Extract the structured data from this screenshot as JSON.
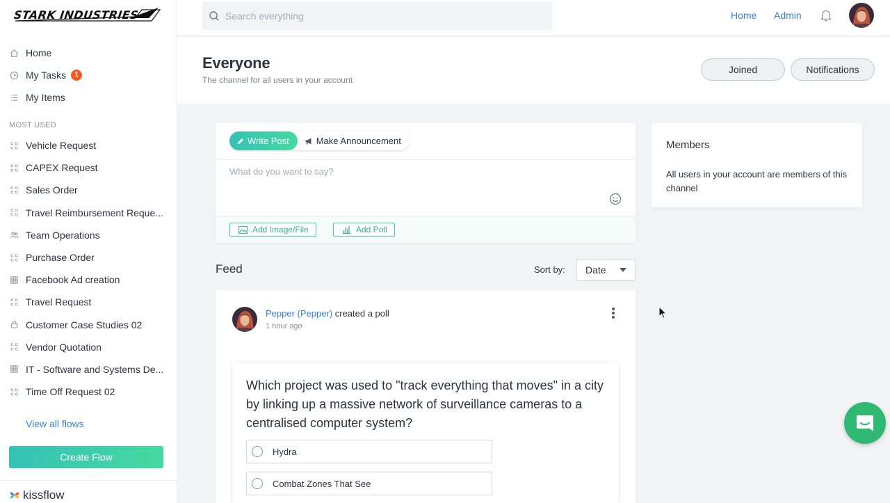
{
  "brand": {
    "name": "STARK INDUSTRIES"
  },
  "nav": {
    "items": [
      {
        "label": "Home",
        "icon": "home-icon"
      },
      {
        "label": "My Tasks",
        "icon": "clock-icon",
        "badge": "1"
      },
      {
        "label": "My Items",
        "icon": "list-icon"
      }
    ]
  },
  "most_used": {
    "label": "MOST USED",
    "items": [
      {
        "label": "Vehicle Request",
        "icon": "flow-icon"
      },
      {
        "label": "CAPEX Request",
        "icon": "flow-icon"
      },
      {
        "label": "Sales Order",
        "icon": "flow-icon"
      },
      {
        "label": "Travel Reimbursement Reque...",
        "icon": "flow-icon"
      },
      {
        "label": "Team Operations",
        "icon": "people-icon"
      },
      {
        "label": "Purchase Order",
        "icon": "flow-icon"
      },
      {
        "label": "Facebook Ad creation",
        "icon": "grid-icon"
      },
      {
        "label": "Travel Request",
        "icon": "flow-icon"
      },
      {
        "label": "Customer Case Studies 02",
        "icon": "lock-icon"
      },
      {
        "label": "Vendor Quotation",
        "icon": "flow-icon"
      },
      {
        "label": "IT - Software and Systems De...",
        "icon": "grid-icon"
      },
      {
        "label": "Time Off Request 02",
        "icon": "flow-icon"
      }
    ],
    "view_all": "View all flows"
  },
  "create_flow": "Create Flow",
  "footer": {
    "logo_text": "kissflow"
  },
  "topbar": {
    "search_placeholder": "Search everything",
    "links": {
      "home": "Home",
      "admin": "Admin"
    }
  },
  "channel": {
    "title": "Everyone",
    "subtitle": "The channel for all users in your account",
    "joined_label": "Joined",
    "notifications_label": "Notifications"
  },
  "composer": {
    "tab_write": "Write Post",
    "tab_announce": "Make Announcement",
    "placeholder": "What do you want to say?",
    "add_image": "Add Image/File",
    "add_poll": "Add Poll"
  },
  "members": {
    "title": "Members",
    "text": "All users in your account are members of this channel"
  },
  "feed": {
    "title": "Feed",
    "sort_label": "Sort by:",
    "sort_value": "Date",
    "post": {
      "author": "Pepper (Pepper)",
      "action": " created a poll",
      "time": "1 hour ago",
      "poll": {
        "question": " Which project was used to \"track everything that moves\" in a city by linking up a massive network of surveillance cameras to a centralised computer system?",
        "options": [
          "Hydra",
          "Combat Zones That See"
        ]
      }
    }
  },
  "colors": {
    "accent_gradient_start": "#35c2b6",
    "accent_gradient_end": "#46d9a0",
    "link": "#3b7fd9",
    "badge": "#f25c1f",
    "chat": "#2eb872"
  }
}
